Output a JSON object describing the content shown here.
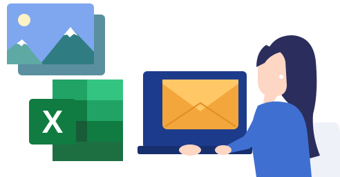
{
  "excel_icon": {
    "letter": "X"
  },
  "colors": {
    "photo_back": "#5a8fa0",
    "photo_front": "#7fa7f0",
    "sun": "#fdf3c4",
    "mountain_dark": "#2f7d83",
    "mountain_light": "#5fa9a4",
    "snow": "#ffffff",
    "excel_dark": "#1d6f42",
    "excel_mid": "#21a366",
    "excel_light": "#33c481",
    "excel_badge": "#107c41",
    "laptop": "#1d3b8b",
    "envelope": "#f3a63b",
    "envelope_flap": "#ffc766",
    "hair": "#2b2e5c",
    "skin": "#fdd6c4",
    "shirt": "#3f6fd1",
    "chair": "#eef1f7"
  }
}
